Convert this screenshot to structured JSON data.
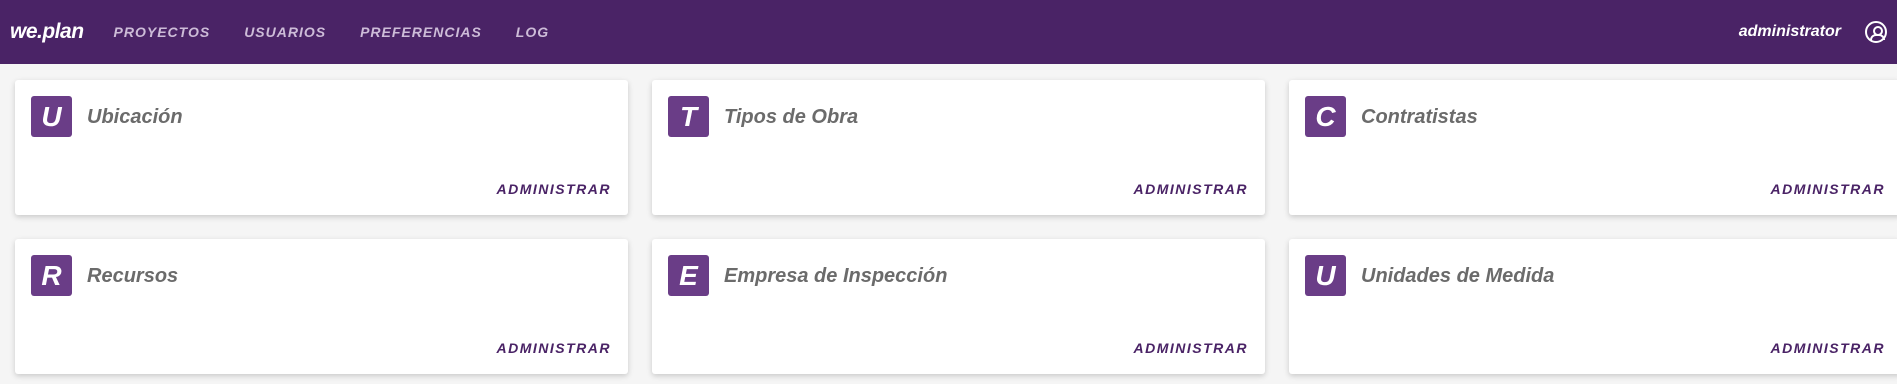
{
  "header": {
    "brand": "we.plan",
    "nav": [
      "PROYECTOS",
      "USUARIOS",
      "PREFERENCIAS",
      "LOG"
    ],
    "username": "administrator",
    "bg_color": "#4a2366"
  },
  "cards": [
    {
      "letter": "U",
      "title": "Ubicación",
      "action": "ADMINISTRAR"
    },
    {
      "letter": "T",
      "title": "Tipos de Obra",
      "action": "ADMINISTRAR"
    },
    {
      "letter": "C",
      "title": "Contratistas",
      "action": "ADMINISTRAR"
    },
    {
      "letter": "R",
      "title": "Recursos",
      "action": "ADMINISTRAR"
    },
    {
      "letter": "E",
      "title": "Empresa de Inspección",
      "action": "ADMINISTRAR"
    },
    {
      "letter": "U",
      "title": "Unidades de Medida",
      "action": "ADMINISTRAR"
    }
  ]
}
